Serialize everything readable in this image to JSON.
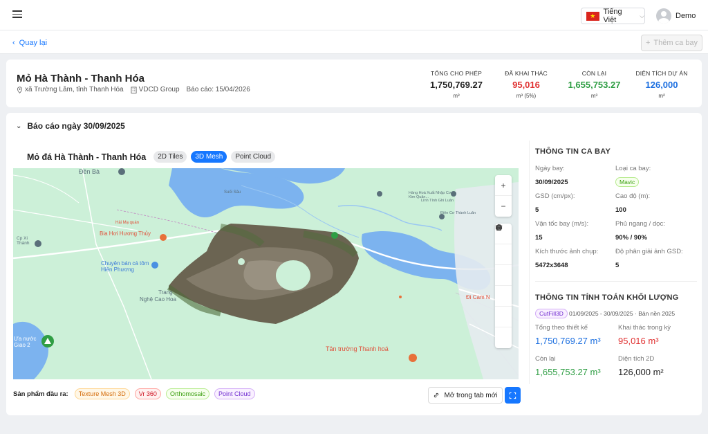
{
  "topbar": {
    "language": "Tiếng Việt",
    "username": "Demo"
  },
  "subbar": {
    "back_label": "Quay lại",
    "add_flight_label": "Thêm ca bay"
  },
  "project": {
    "title": "Mỏ Hà Thành - Thanh Hóa",
    "location": "xã Trường Lâm, tỉnh Thanh Hóa",
    "company": "VDCD Group",
    "report_date": "Báo cáo: 15/04/2026",
    "stats": [
      {
        "label": "TỔNG CHO PHÉP",
        "value": "1,750,769.27",
        "unit": "m³",
        "color": "#222222"
      },
      {
        "label": "ĐÃ KHAI THÁC",
        "value": "95,016",
        "unit": "m³ (5%)",
        "color": "#e03131"
      },
      {
        "label": "CÒN LẠI",
        "value": "1,655,753.27",
        "unit": "m³",
        "color": "#2f9e44"
      },
      {
        "label": "DIỆN TÍCH DỰ ÁN",
        "value": "126,000",
        "unit": "m²",
        "color": "#1c6fe0"
      }
    ]
  },
  "report": {
    "title": "Báo cáo ngày 30/09/2025",
    "map_title": "Mỏ đá Hà Thành - Thanh Hóa",
    "tabs": [
      "2D Tiles",
      "3D Mesh",
      "Point Cloud"
    ],
    "active_tab": "3D Mesh",
    "map_labels": [
      "Đền Bà",
      "Suối Sâu",
      "Hải Mạ quán",
      "Bia Hơi Hương Thủy",
      "Chuyên bán cá tôm Hiền Phương",
      "Trang",
      "Nghệ Cao Hoa",
      "Điện Cơ Thành Luân",
      "Hàng Hoá Xuất Nhập Cơ Kim Quân...",
      "Lính Tính Ghi Luân",
      "Cp Xi Thành",
      "Đi Cam N",
      "Tân trường Thanh hoá",
      "Ưa nước Giao 2"
    ],
    "products_label": "Sản phẩm đầu ra:",
    "products": [
      {
        "label": "Texture Mesh 3D",
        "color": "#d46b08"
      },
      {
        "label": "Vr 360",
        "color": "#cf1322"
      },
      {
        "label": "Orthomosaic",
        "color": "#389e0d"
      },
      {
        "label": "Point Cloud",
        "color": "#722ed1"
      }
    ],
    "open_tab_label": "Mở trong tab mới"
  },
  "flight_info": {
    "heading": "THÔNG TIN CA BAY",
    "fields": [
      {
        "label": "Ngày bay:",
        "value": "30/09/2025"
      },
      {
        "label": "Loại ca bay:",
        "value": "Mavic"
      },
      {
        "label": "GSD (cm/px):",
        "value": "5"
      },
      {
        "label": "Cao độ (m):",
        "value": "100"
      },
      {
        "label": "Vận tốc bay (m/s):",
        "value": "15"
      },
      {
        "label": "Phủ ngang / dọc:",
        "value": "90% / 90%"
      },
      {
        "label": "Kích thước ảnh chụp:",
        "value": "5472x3648"
      },
      {
        "label": "Độ phân giải ảnh GSD:",
        "value": "5"
      }
    ]
  },
  "volume_info": {
    "heading": "THÔNG TIN TÍNH TOÁN KHỐI LƯỢNG",
    "method": "CutFill3D",
    "period": "01/09/2025 - 30/09/2025 · Bản nền 2025",
    "items": [
      {
        "label": "Tổng theo thiết kế",
        "value": "1,750,769.27 m³",
        "color": "#1c6fe0"
      },
      {
        "label": "Khai thác trong kỳ",
        "value": "95,016 m³",
        "color": "#e03131"
      },
      {
        "label": "Còn lại",
        "value": "1,655,753.27 m³",
        "color": "#2f9e44"
      },
      {
        "label": "Diện tích 2D",
        "value": "126,000 m²",
        "color": "#222222"
      }
    ]
  }
}
